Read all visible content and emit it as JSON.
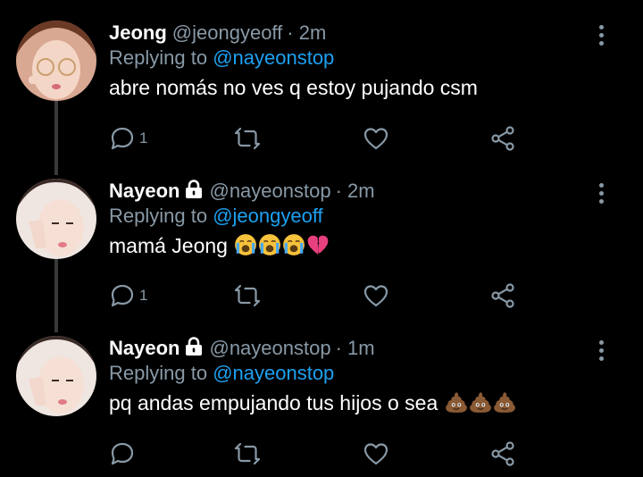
{
  "tweets": [
    {
      "name": "Jeong",
      "locked": false,
      "handle": "@jeongyeoff",
      "time": "· 2m",
      "replying_prefix": "Replying to",
      "replying_handle": "@nayeonstop",
      "text": "abre nomás no ves q estoy pujando csm",
      "reply_count": "1",
      "emojis": []
    },
    {
      "name": "Nayeon",
      "locked": true,
      "handle": "@nayeonstop",
      "time": "· 2m",
      "replying_prefix": "Replying to",
      "replying_handle": "@jeongyeoff",
      "text": "mamá Jeong",
      "reply_count": "1",
      "emojis": [
        "crying-face",
        "crying-face",
        "crying-face",
        "broken-heart"
      ]
    },
    {
      "name": "Nayeon",
      "locked": true,
      "handle": "@nayeonstop",
      "time": "· 1m",
      "replying_prefix": "Replying to",
      "replying_handle": "@nayeonstop",
      "text": "pq andas empujando tus hijos o sea",
      "reply_count": "",
      "emojis": [
        "poop",
        "poop",
        "poop"
      ]
    }
  ],
  "colors": {
    "background": "#000000",
    "text": "#ffffff",
    "secondary": "#8899a6",
    "link": "#1da1f2",
    "thread_line": "#3a3a3a"
  },
  "icons": {
    "reply": "reply-icon",
    "retweet": "retweet-icon",
    "like": "heart-icon",
    "share": "share-icon",
    "more": "more-vertical-icon",
    "lock": "lock-icon"
  }
}
